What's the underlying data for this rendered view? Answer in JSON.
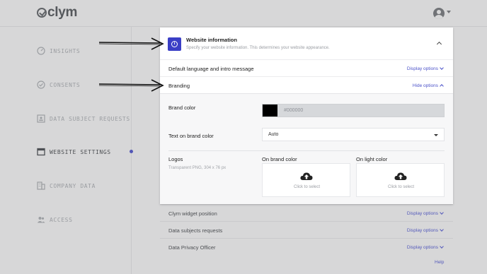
{
  "app": {
    "logo_text": "clym",
    "user_icon": "user-circle-icon"
  },
  "sidebar": {
    "items": [
      {
        "label": "INSIGHTS",
        "icon": "gauge-icon",
        "active": false
      },
      {
        "label": "CONSENTS",
        "icon": "check-circle-icon",
        "active": false
      },
      {
        "label": "DATA SUBJECT REQUESTS",
        "icon": "person-card-icon",
        "active": false
      },
      {
        "label": "WEBSITE SETTINGS",
        "icon": "browser-window-icon",
        "active": true
      },
      {
        "label": "COMPANY DATA",
        "icon": "building-icon",
        "active": false
      },
      {
        "label": "ACCESS",
        "icon": "users-icon",
        "active": false
      }
    ],
    "active_indicator_color": "#4a4fc4"
  },
  "card": {
    "title": "Website information",
    "subtitle": "Specify your website information. This determines your website appearance.",
    "badge_icon": "info-icon",
    "badge_color": "#3b3fc6"
  },
  "sections": {
    "language": {
      "label": "Default language and intro message",
      "action": "Display options"
    },
    "branding": {
      "label": "Branding",
      "action": "Hide options"
    }
  },
  "branding": {
    "brand_color_label": "Brand color",
    "brand_color_value": "#000000",
    "text_on_brand_label": "Text on brand color",
    "text_on_brand_value": "Auto",
    "logos_label": "Logos",
    "logos_hint": "Transparent PNG, 304 x 76 px",
    "on_brand_label": "On brand color",
    "on_light_label": "On light color",
    "upload_text": "Click to select"
  },
  "more_rows": [
    {
      "label": "Clym widget position",
      "action": "Display options"
    },
    {
      "label": "Data subjects requests",
      "action": "Display options"
    },
    {
      "label": "Data Privacy Officer",
      "action": "Display options"
    }
  ],
  "help_label": "Help",
  "accent_color": "#4b52c9"
}
